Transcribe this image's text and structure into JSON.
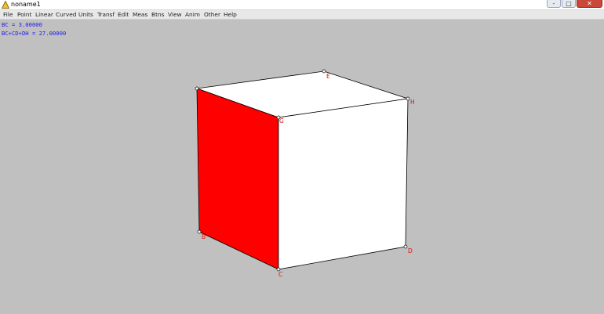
{
  "window": {
    "title": "noname1",
    "icon": "triangle-app-icon",
    "controls": {
      "minimize": "-",
      "maximize": "□",
      "close": "✕"
    }
  },
  "menu": [
    "File",
    "Point",
    "Linear",
    "Curved",
    "Units",
    "Transf",
    "Edit",
    "Meas",
    "Btns",
    "View",
    "Anim",
    "Other",
    "Help"
  ],
  "measurements": [
    "BC = 3.00000",
    "BC+CD+DH = 27.00000"
  ],
  "vertices": {
    "E": "E",
    "H": "H",
    "G": "G",
    "B": "B",
    "C": "C",
    "D": "D"
  },
  "colors": {
    "background": "#c0c0c0",
    "highlighted_face": "#ff0000",
    "face": "#ffffff",
    "edge": "#000000",
    "label": "#e01010",
    "measurement_text": "#1a1aee"
  }
}
